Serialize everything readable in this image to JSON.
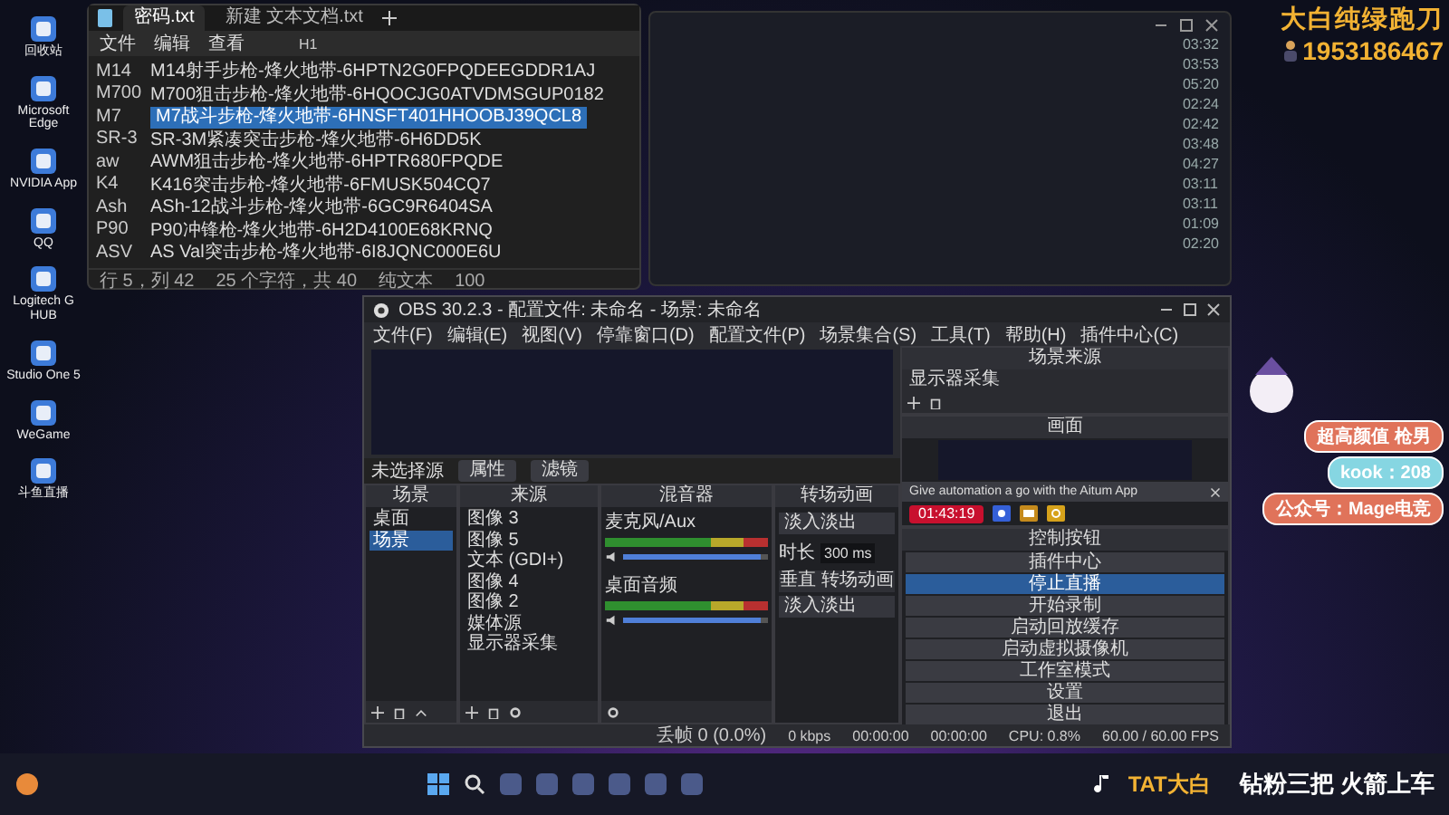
{
  "desktop_icons": [
    {
      "label": "回收站"
    },
    {
      "label": "Microsoft Edge"
    },
    {
      "label": "NVIDIA App"
    },
    {
      "label": "QQ"
    },
    {
      "label": "Logitech G HUB"
    },
    {
      "label": "Studio One 5"
    },
    {
      "label": "WeGame"
    },
    {
      "label": "斗鱼直播"
    }
  ],
  "notepad": {
    "tabs": [
      {
        "label": "密码.txt",
        "selected": true
      },
      {
        "label": "新建 文本文档.txt",
        "selected": false
      }
    ],
    "menu": [
      "文件",
      "编辑",
      "查看"
    ],
    "heading_dropdown": "H1",
    "lines": [
      {
        "key": "M14",
        "value": "M14射手步枪-烽火地带-6HPTN2G0FPQDEEGDDR1AJ",
        "selected": false
      },
      {
        "key": "M700",
        "value": "M700狙击步枪-烽火地带-6HQOCJG0ATVDMSGUP0182",
        "selected": false
      },
      {
        "key": "M7",
        "value": "M7战斗步枪-烽火地带-6HNSFT401HHOOBJ39QCL8",
        "selected": true
      },
      {
        "key": "SR-3",
        "value": "SR-3M紧凑突击步枪-烽火地带-6H6DD5K",
        "selected": false
      },
      {
        "key": "aw",
        "value": "AWM狙击步枪-烽火地带-6HPTR680FPQDE",
        "selected": false
      },
      {
        "key": "K4",
        "value": "K416突击步枪-烽火地带-6FMUSK504CQ7",
        "selected": false
      },
      {
        "key": "Ash",
        "value": "ASh-12战斗步枪-烽火地带-6GC9R6404SA",
        "selected": false
      },
      {
        "key": "P90",
        "value": "P90冲锋枪-烽火地带-6H2D4100E68KRNQ",
        "selected": false
      },
      {
        "key": "ASV",
        "value": "AS Val突击步枪-烽火地带-6I8JQNC000E6U",
        "selected": false
      }
    ],
    "status": [
      "行 5，列 42",
      "25 个字符，共 40",
      "纯文本",
      "100"
    ]
  },
  "playlist_durations": [
    "03:32",
    "03:53",
    "05:20",
    "02:24",
    "02:42",
    "03:48",
    "04:27",
    "03:11",
    "03:11",
    "01:09",
    "02:20"
  ],
  "obs": {
    "title": "OBS 30.2.3 - 配置文件: 未命名 - 场景: 未命名",
    "menu": [
      "文件(F)",
      "编辑(E)",
      "视图(V)",
      "停靠窗口(D)",
      "配置文件(P)",
      "场景集合(S)",
      "工具(T)",
      "帮助(H)",
      "插件中心(C)"
    ],
    "no_source_label": "未选择源",
    "source_buttons": [
      "属性",
      "滤镜"
    ],
    "scenes": {
      "title": "场景",
      "items": [
        {
          "label": "桌面",
          "selected": false
        },
        {
          "label": "场景",
          "selected": true
        }
      ]
    },
    "sources": {
      "title": "来源",
      "items": [
        "图像 3",
        "图像 5",
        "文本 (GDI+)",
        "图像 4",
        "图像 2",
        "媒体源",
        "显示器采集"
      ]
    },
    "mixer": {
      "title": "混音器",
      "channels": [
        {
          "name": "麦克风/Aux",
          "level": 0.95
        },
        {
          "name": "桌面音频",
          "level": 0.95
        }
      ]
    },
    "transition": {
      "title": "转场动画",
      "type": "淡入淡出",
      "duration_label": "时长",
      "duration": "300 ms"
    },
    "vertical_transition": {
      "title": "垂直 转场动画",
      "type": "淡入淡出"
    },
    "side_sources": {
      "title": "场景来源",
      "items": [
        "显示器采集"
      ]
    },
    "side_preview": {
      "title": "画面",
      "banner": "Give automation a go with the Aitum App",
      "live_time": "01:43:19"
    },
    "controls": {
      "title": "控制按钮",
      "buttons": [
        {
          "label": "插件中心",
          "selected": false
        },
        {
          "label": "停止直播",
          "selected": true
        },
        {
          "label": "开始录制",
          "selected": false
        },
        {
          "label": "启动回放缓存",
          "selected": false
        },
        {
          "label": "启动虚拟摄像机",
          "selected": false
        },
        {
          "label": "工作室模式",
          "selected": false
        },
        {
          "label": "设置",
          "selected": false
        },
        {
          "label": "退出",
          "selected": false
        }
      ]
    },
    "status": [
      "丢帧 0 (0.0%)",
      "0 kbps",
      "00:00:00",
      "00:00:00",
      "CPU: 0.8%",
      "60.00 / 60.00 FPS"
    ]
  },
  "overlay": {
    "title": "大白纯绿跑刀",
    "phone": "1953186467",
    "tags": [
      {
        "label": "超高颜值 枪男",
        "color": "#e0735a"
      },
      {
        "label": "kook：208",
        "color": "#86d6e2"
      },
      {
        "label": "公众号：Mage电竞",
        "color": "#e0735a"
      }
    ],
    "brand": "TAT大白",
    "slogan": "钻粉三把 火箭上车"
  }
}
